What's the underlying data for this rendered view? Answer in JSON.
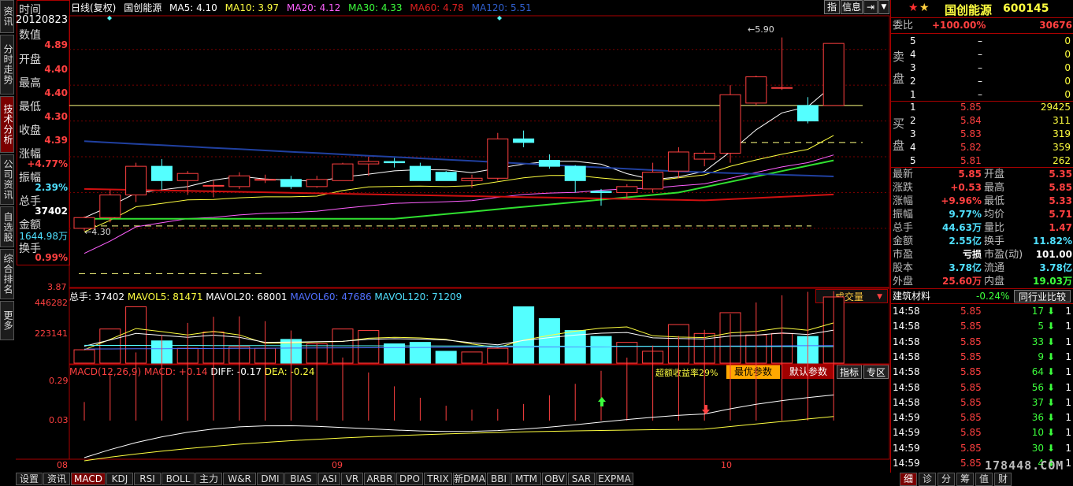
{
  "left_tabs": [
    "资讯",
    "分时走势",
    "技术分析",
    "公司资讯",
    "自选股",
    "综合排名",
    "更多"
  ],
  "left_tabs_active": 2,
  "info": {
    "date_label": "时间",
    "date": "20120823",
    "val_label": "数值",
    "val": "4.89",
    "open_label": "开盘",
    "open": "4.40",
    "high_label": "最高",
    "high": "4.40",
    "low_label": "最低",
    "low": "4.30",
    "close_label": "收盘",
    "close": "4.39",
    "chg_label": "涨幅",
    "chg": "+4.77%",
    "amp_label": "振幅",
    "amp": "2.39%",
    "vol_label": "总手",
    "vol": "37402",
    "amt_label": "金额",
    "amt": "1644.98万",
    "turn_label": "换手",
    "turn": "0.99%"
  },
  "chart_header": {
    "period": "日线(复权)",
    "name": "国创能源",
    "ma5": "MA5: 4.10",
    "ma10": "MA10: 3.97",
    "ma20": "MA20: 4.12",
    "ma30": "MA30: 4.33",
    "ma60": "MA60: 4.78",
    "ma120": "MA120: 5.51",
    "btn_zhi": "指",
    "btn_info": "信息"
  },
  "price_axis": {
    "label_high": "5.90",
    "label_low": "4.30",
    "bottom": "3.87"
  },
  "volume_header": {
    "total": "总手: 37402",
    "mavol5": "MAVOL5: 81471",
    "mavol20": "MAVOL20: 68001",
    "mavol60": "MAVOL60: 47686",
    "mavol120": "MAVOL120: 71209",
    "dropdown": "成交量",
    "axis_top": "446282",
    "axis_mid": "223141"
  },
  "macd_header": {
    "macd": "MACD(12,26,9)",
    "macd_val": "MACD: +0.14",
    "diff": "DIFF: -0.17",
    "dea": "DEA: -0.24",
    "profit": "超额收益率29%",
    "btn_best": "最优参数",
    "btn_default": "默认参数",
    "btn_index": "指标",
    "btn_zone": "专区",
    "axis_top": "0.29",
    "axis_mid": "0.03"
  },
  "x_axis": {
    "m08": "08",
    "m09": "09",
    "m10": "10"
  },
  "bottom_tabs": [
    "设置",
    "资讯",
    "MACD",
    "KDJ",
    "RSI",
    "BOLL",
    "主力",
    "W&R",
    "DMI",
    "BIAS",
    "ASI",
    "VR",
    "ARBR",
    "DPO",
    "TRIX",
    "新DMA",
    "BBI",
    "MTM",
    "OBV",
    "SAR",
    "EXPMA"
  ],
  "bottom_tabs_active": 2,
  "right": {
    "name": "国创能源",
    "code": "600145",
    "weibi_label": "委比",
    "weibi": "+100.00%",
    "weicha": "30676",
    "sell_label": "卖盘",
    "buy_label": "买盘",
    "sell": [
      {
        "lvl": "5",
        "price": "–",
        "vol": "0"
      },
      {
        "lvl": "4",
        "price": "–",
        "vol": "0"
      },
      {
        "lvl": "3",
        "price": "–",
        "vol": "0"
      },
      {
        "lvl": "2",
        "price": "–",
        "vol": "0"
      },
      {
        "lvl": "1",
        "price": "–",
        "vol": "0"
      }
    ],
    "buy": [
      {
        "lvl": "1",
        "price": "5.85",
        "vol": "29425"
      },
      {
        "lvl": "2",
        "price": "5.84",
        "vol": "311"
      },
      {
        "lvl": "3",
        "price": "5.83",
        "vol": "319"
      },
      {
        "lvl": "4",
        "price": "5.82",
        "vol": "359"
      },
      {
        "lvl": "5",
        "price": "5.81",
        "vol": "262"
      }
    ],
    "stats": [
      {
        "l1": "最新",
        "v1": "5.85",
        "l2": "开盘",
        "v2": "5.35"
      },
      {
        "l1": "涨跌",
        "v1": "+0.53",
        "l2": "最高",
        "v2": "5.85"
      },
      {
        "l1": "涨幅",
        "v1": "+9.96%",
        "l2": "最低",
        "v2": "5.33"
      },
      {
        "l1": "振幅",
        "v1": "9.77%",
        "l2": "均价",
        "v2": "5.71"
      },
      {
        "l1": "总手",
        "v1": "44.63万",
        "l2": "量比",
        "v2": "1.47"
      },
      {
        "l1": "金额",
        "v1": "2.55亿",
        "l2": "换手",
        "v2": "11.82%"
      },
      {
        "l1": "市盈",
        "v1": "亏损",
        "l2": "市盈(动)",
        "v2": "101.00"
      },
      {
        "l1": "股本",
        "v1": "3.78亿",
        "l2": "流通",
        "v2": "3.78亿"
      },
      {
        "l1": "外盘",
        "v1": "25.60万",
        "l2": "内盘",
        "v2": "19.03万"
      }
    ],
    "industry": "建筑材料",
    "industry_chg": "-0.24%",
    "industry_btn": "同行业比较",
    "ticks": [
      {
        "t": "14:58",
        "p": "5.85",
        "v": "17",
        "n": "1"
      },
      {
        "t": "14:58",
        "p": "5.85",
        "v": "5",
        "n": "1"
      },
      {
        "t": "14:58",
        "p": "5.85",
        "v": "33",
        "n": "1"
      },
      {
        "t": "14:58",
        "p": "5.85",
        "v": "9",
        "n": "1"
      },
      {
        "t": "14:58",
        "p": "5.85",
        "v": "64",
        "n": "1"
      },
      {
        "t": "14:58",
        "p": "5.85",
        "v": "56",
        "n": "1"
      },
      {
        "t": "14:58",
        "p": "5.85",
        "v": "37",
        "n": "1"
      },
      {
        "t": "14:59",
        "p": "5.85",
        "v": "36",
        "n": "1"
      },
      {
        "t": "14:59",
        "p": "5.85",
        "v": "10",
        "n": "1"
      },
      {
        "t": "14:59",
        "p": "5.85",
        "v": "30",
        "n": "1"
      },
      {
        "t": "14:59",
        "p": "5.85",
        "v": "4",
        "n": "1"
      }
    ],
    "tabs": [
      "细",
      "诊",
      "分",
      "筹",
      "值",
      "财"
    ],
    "watermark": "178448.COM"
  },
  "chart_data": {
    "type": "candlestick",
    "dates_visible": [
      "08",
      "09",
      "10"
    ],
    "ylim": [
      3.87,
      5.95
    ],
    "candles": [
      {
        "o": 4.3,
        "h": 4.4,
        "l": 4.28,
        "c": 4.39
      },
      {
        "o": 4.39,
        "h": 4.62,
        "l": 4.35,
        "c": 4.58
      },
      {
        "o": 4.58,
        "h": 4.85,
        "l": 4.52,
        "c": 4.82
      },
      {
        "o": 4.82,
        "h": 4.88,
        "l": 4.62,
        "c": 4.7
      },
      {
        "o": 4.7,
        "h": 4.78,
        "l": 4.58,
        "c": 4.76
      },
      {
        "o": 4.66,
        "h": 4.7,
        "l": 4.56,
        "c": 4.66
      },
      {
        "o": 4.65,
        "h": 4.77,
        "l": 4.63,
        "c": 4.74
      },
      {
        "o": 4.71,
        "h": 4.75,
        "l": 4.68,
        "c": 4.71
      },
      {
        "o": 4.71,
        "h": 4.74,
        "l": 4.63,
        "c": 4.65
      },
      {
        "o": 4.65,
        "h": 4.74,
        "l": 4.64,
        "c": 4.71
      },
      {
        "o": 4.7,
        "h": 4.85,
        "l": 4.7,
        "c": 4.84
      },
      {
        "o": 4.84,
        "h": 4.9,
        "l": 4.74,
        "c": 4.86
      },
      {
        "o": 4.86,
        "h": 4.89,
        "l": 4.81,
        "c": 4.85
      },
      {
        "o": 4.82,
        "h": 4.85,
        "l": 4.7,
        "c": 4.7
      },
      {
        "o": 4.77,
        "h": 4.78,
        "l": 4.7,
        "c": 4.7
      },
      {
        "o": 4.7,
        "h": 4.75,
        "l": 4.64,
        "c": 4.72
      },
      {
        "o": 4.72,
        "h": 5.1,
        "l": 4.7,
        "c": 5.05
      },
      {
        "o": 5.05,
        "h": 5.12,
        "l": 4.98,
        "c": 5.02
      },
      {
        "o": 4.87,
        "h": 4.92,
        "l": 4.8,
        "c": 4.82
      },
      {
        "o": 4.82,
        "h": 4.83,
        "l": 4.6,
        "c": 4.7
      },
      {
        "o": 4.61,
        "h": 4.63,
        "l": 4.49,
        "c": 4.6
      },
      {
        "o": 4.6,
        "h": 4.67,
        "l": 4.55,
        "c": 4.65
      },
      {
        "o": 4.63,
        "h": 4.85,
        "l": 4.6,
        "c": 4.77
      },
      {
        "o": 4.78,
        "h": 4.98,
        "l": 4.72,
        "c": 4.94
      },
      {
        "o": 4.88,
        "h": 4.95,
        "l": 4.82,
        "c": 4.93
      },
      {
        "o": 4.93,
        "h": 5.5,
        "l": 4.85,
        "c": 5.42
      },
      {
        "o": 5.35,
        "h": 5.58,
        "l": 5.33,
        "c": 5.57
      },
      {
        "o": 5.48,
        "h": 5.9,
        "l": 5.46,
        "c": 5.48
      },
      {
        "o": 5.33,
        "h": 5.4,
        "l": 5.18,
        "c": 5.2
      },
      {
        "o": 5.33,
        "h": 5.85,
        "l": 5.33,
        "c": 5.85
      }
    ],
    "volume": [
      90,
      230,
      380,
      150,
      100,
      210,
      110,
      100,
      160,
      130,
      230,
      220,
      130,
      140,
      80,
      75,
      100,
      380,
      300,
      220,
      180,
      140,
      80,
      260,
      200,
      340,
      190,
      200,
      180,
      446
    ],
    "volume_ylim": [
      0,
      446282
    ],
    "macd_ylim": [
      -0.25,
      0.29
    ]
  }
}
